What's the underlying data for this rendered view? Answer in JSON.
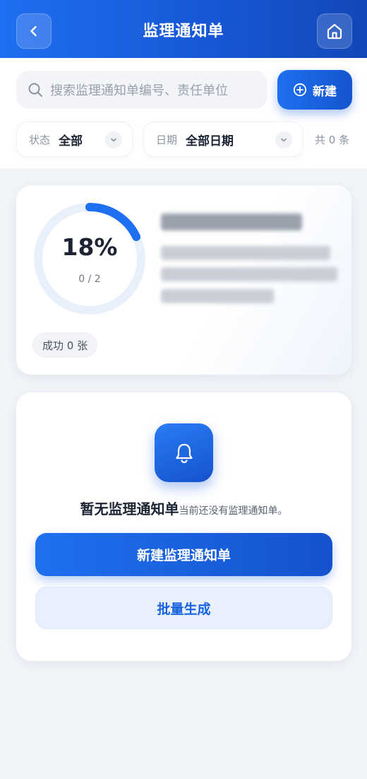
{
  "header": {
    "title": "监理通知单",
    "back_icon": "chevron-left-icon",
    "home_icon": "home-icon"
  },
  "search": {
    "placeholder": "搜索监理通知单编号、责任单位",
    "icon": "search-icon"
  },
  "new_button": {
    "label": "新建",
    "icon": "plus-circle-icon"
  },
  "filters": {
    "status": {
      "label": "状态",
      "value": "全部"
    },
    "date": {
      "label": "日期",
      "value": "全部日期"
    },
    "count": "共 0 条"
  },
  "progress": {
    "percent_text": "18%",
    "percent": 18,
    "ratio": "0 / 2",
    "success": "成功 0 张"
  },
  "empty": {
    "icon": "bell-icon",
    "title": "暂无监理通知单",
    "subtitle": "当前还没有监理通知单。",
    "primary_label": "新建监理通知单",
    "secondary_label": "批量生成"
  },
  "colors": {
    "accent": "#1a63e0",
    "ring_track": "#e8f0fb",
    "ring_fill": "#1f70f0"
  }
}
